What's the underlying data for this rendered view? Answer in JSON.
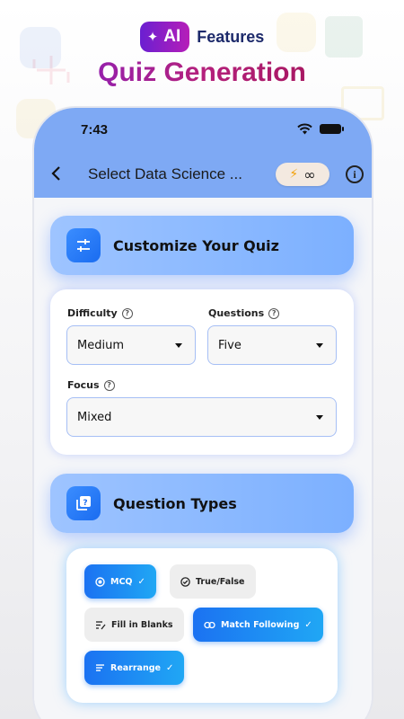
{
  "promo": {
    "ai_badge": "AI",
    "features": "Features",
    "title": "Quiz Generation"
  },
  "status_bar": {
    "time": "7:43"
  },
  "nav": {
    "title": "Select Data Science ...",
    "credits": "∞"
  },
  "customize": {
    "title": "Customize Your Quiz",
    "difficulty": {
      "label": "Difficulty",
      "value": "Medium"
    },
    "questions": {
      "label": "Questions",
      "value": "Five"
    },
    "focus": {
      "label": "Focus",
      "value": "Mixed"
    }
  },
  "question_types": {
    "title": "Question Types",
    "chips": [
      {
        "label": "MCQ",
        "selected": true
      },
      {
        "label": "True/False",
        "selected": false
      },
      {
        "label": "Fill in Blanks",
        "selected": false
      },
      {
        "label": "Match Following",
        "selected": true
      },
      {
        "label": "Rearrange",
        "selected": true
      }
    ]
  },
  "colors": {
    "header_bar": "#7ea9f4",
    "section_header": "#8cbaff",
    "chip_selected": "#1b72f2",
    "chip_unselected": "#eeeeee",
    "title_gradient_start": "#7b1fd6",
    "title_gradient_end": "#9d0f4a"
  }
}
